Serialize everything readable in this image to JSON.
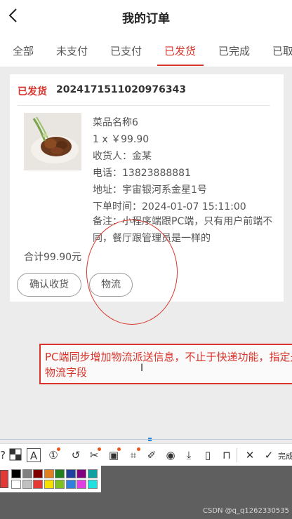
{
  "header": {
    "title": "我的订单",
    "back_icon": "chevron-left-icon"
  },
  "tabs": [
    {
      "label": "全部",
      "active": false
    },
    {
      "label": "未支付",
      "active": false
    },
    {
      "label": "已支付",
      "active": false
    },
    {
      "label": "已发货",
      "active": true
    },
    {
      "label": "已完成",
      "active": false
    },
    {
      "label": "已取",
      "active": false
    }
  ],
  "order": {
    "status": "已发货",
    "order_no": "2024171511020976343",
    "lines": [
      "菜品名称6",
      "1 x ￥99.90",
      "收货人：金某",
      "电话：13823888881",
      "地址：宇宙银河系金星1号",
      "下单时间：2024-01-07 15:11:00"
    ],
    "remark": "备注：小程序端跟PC端，只有用户前端不同，餐厅跟管理员是一样的",
    "total": "合计99.90元",
    "buttons": {
      "confirm": "确认收货",
      "logistics": "物流"
    }
  },
  "annotation": {
    "text": "PC端同步增加物流派送信息，不止于快递功能，指定是物流字段",
    "color": "#d9342b"
  },
  "toolbar": {
    "done_label": "完成",
    "icons": [
      "rectangle-icon",
      "mosaic-icon",
      "text-icon",
      "number-icon",
      "undo-icon",
      "cut-icon",
      "ocr-icon",
      "crop-icon",
      "pin-icon",
      "record-icon",
      "download-icon",
      "phone-icon",
      "bookmark-icon",
      "close-icon",
      "check-icon"
    ]
  },
  "palette": {
    "current": "#e53935",
    "colors": [
      "#000000",
      "#808080",
      "#800000",
      "#e08020",
      "#208020",
      "#2040a0",
      "#800080",
      "#10a0a0",
      "#ffffff",
      "#c0c0c0",
      "#e53935",
      "#f5e000",
      "#80c020",
      "#3080e0",
      "#e040e0",
      "#20e0e0"
    ]
  },
  "watermark": "CSDN @q_q1262330535",
  "colors": {
    "accent": "#d9342b"
  }
}
